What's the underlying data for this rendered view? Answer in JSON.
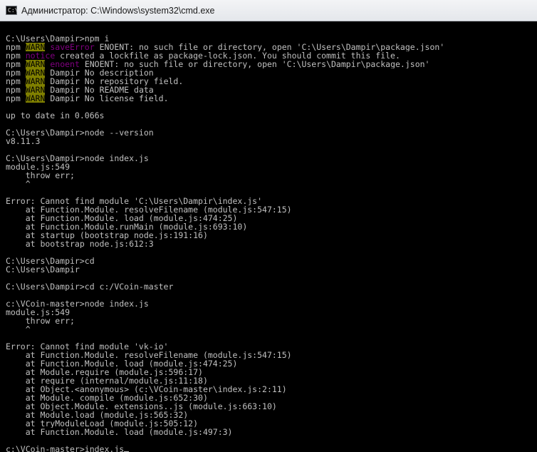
{
  "window": {
    "title": "Администратор: C:\\Windows\\system32\\cmd.exe",
    "icon_text": "C:\\"
  },
  "lines": [
    {
      "segs": [
        {
          "t": ""
        }
      ]
    },
    {
      "segs": [
        {
          "t": "C:\\Users\\Dampir>npm i"
        }
      ]
    },
    {
      "segs": [
        {
          "t": "npm "
        },
        {
          "t": "WARN",
          "c": "warn"
        },
        {
          "t": " "
        },
        {
          "t": "saveError",
          "c": "err"
        },
        {
          "t": " ENOENT: no such file or directory, open 'C:\\Users\\Dampir\\package.json'"
        }
      ]
    },
    {
      "segs": [
        {
          "t": "npm "
        },
        {
          "t": "notice",
          "c": "err"
        },
        {
          "t": " created a lockfile as package-lock.json. You should commit this file."
        }
      ]
    },
    {
      "segs": [
        {
          "t": "npm "
        },
        {
          "t": "WARN",
          "c": "warn"
        },
        {
          "t": " "
        },
        {
          "t": "enoent",
          "c": "err"
        },
        {
          "t": " ENOENT: no such file or directory, open 'C:\\Users\\Dampir\\package.json'"
        }
      ]
    },
    {
      "segs": [
        {
          "t": "npm "
        },
        {
          "t": "WARN",
          "c": "warn"
        },
        {
          "t": " Dampir No description"
        }
      ]
    },
    {
      "segs": [
        {
          "t": "npm "
        },
        {
          "t": "WARN",
          "c": "warn"
        },
        {
          "t": " Dampir No repository field."
        }
      ]
    },
    {
      "segs": [
        {
          "t": "npm "
        },
        {
          "t": "WARN",
          "c": "warn"
        },
        {
          "t": " Dampir No README data"
        }
      ]
    },
    {
      "segs": [
        {
          "t": "npm "
        },
        {
          "t": "WARN",
          "c": "warn"
        },
        {
          "t": " Dampir No license field."
        }
      ]
    },
    {
      "segs": [
        {
          "t": ""
        }
      ]
    },
    {
      "segs": [
        {
          "t": "up to date in 0.066s"
        }
      ]
    },
    {
      "segs": [
        {
          "t": ""
        }
      ]
    },
    {
      "segs": [
        {
          "t": "C:\\Users\\Dampir>node --version"
        }
      ]
    },
    {
      "segs": [
        {
          "t": "v8.11.3"
        }
      ]
    },
    {
      "segs": [
        {
          "t": ""
        }
      ]
    },
    {
      "segs": [
        {
          "t": "C:\\Users\\Dampir>node index.js"
        }
      ]
    },
    {
      "segs": [
        {
          "t": "module.js:549"
        }
      ]
    },
    {
      "segs": [
        {
          "t": "    throw err;"
        }
      ]
    },
    {
      "segs": [
        {
          "t": "    ^"
        }
      ]
    },
    {
      "segs": [
        {
          "t": ""
        }
      ]
    },
    {
      "segs": [
        {
          "t": "Error: Cannot find module 'C:\\Users\\Dampir\\index.js'"
        }
      ]
    },
    {
      "segs": [
        {
          "t": "    at Function.Module._resolveFilename (module.js:547:15)"
        }
      ]
    },
    {
      "segs": [
        {
          "t": "    at Function.Module._load (module.js:474:25)"
        }
      ]
    },
    {
      "segs": [
        {
          "t": "    at Function.Module.runMain (module.js:693:10)"
        }
      ]
    },
    {
      "segs": [
        {
          "t": "    at startup (bootstrap_node.js:191:16)"
        }
      ]
    },
    {
      "segs": [
        {
          "t": "    at bootstrap_node.js:612:3"
        }
      ]
    },
    {
      "segs": [
        {
          "t": ""
        }
      ]
    },
    {
      "segs": [
        {
          "t": "C:\\Users\\Dampir>cd"
        }
      ]
    },
    {
      "segs": [
        {
          "t": "C:\\Users\\Dampir"
        }
      ]
    },
    {
      "segs": [
        {
          "t": ""
        }
      ]
    },
    {
      "segs": [
        {
          "t": "C:\\Users\\Dampir>cd c:/VCoin-master"
        }
      ]
    },
    {
      "segs": [
        {
          "t": ""
        }
      ]
    },
    {
      "segs": [
        {
          "t": "c:\\VCoin-master>node index.js"
        }
      ]
    },
    {
      "segs": [
        {
          "t": "module.js:549"
        }
      ]
    },
    {
      "segs": [
        {
          "t": "    throw err;"
        }
      ]
    },
    {
      "segs": [
        {
          "t": "    ^"
        }
      ]
    },
    {
      "segs": [
        {
          "t": ""
        }
      ]
    },
    {
      "segs": [
        {
          "t": "Error: Cannot find module 'vk-io'"
        }
      ]
    },
    {
      "segs": [
        {
          "t": "    at Function.Module._resolveFilename (module.js:547:15)"
        }
      ]
    },
    {
      "segs": [
        {
          "t": "    at Function.Module._load (module.js:474:25)"
        }
      ]
    },
    {
      "segs": [
        {
          "t": "    at Module.require (module.js:596:17)"
        }
      ]
    },
    {
      "segs": [
        {
          "t": "    at require (internal/module.js:11:18)"
        }
      ]
    },
    {
      "segs": [
        {
          "t": "    at Object.<anonymous> (c:\\VCoin-master\\index.js:2:11)"
        }
      ]
    },
    {
      "segs": [
        {
          "t": "    at Module._compile (module.js:652:30)"
        }
      ]
    },
    {
      "segs": [
        {
          "t": "    at Object.Module._extensions..js (module.js:663:10)"
        }
      ]
    },
    {
      "segs": [
        {
          "t": "    at Module.load (module.js:565:32)"
        }
      ]
    },
    {
      "segs": [
        {
          "t": "    at tryModuleLoad (module.js:505:12)"
        }
      ]
    },
    {
      "segs": [
        {
          "t": "    at Function.Module._load (module.js:497:3)"
        }
      ]
    },
    {
      "segs": [
        {
          "t": ""
        }
      ]
    },
    {
      "segs": [
        {
          "t": "c:\\VCoin-master>index.js"
        }
      ],
      "cursor": true
    }
  ],
  "colors": {
    "background": "#000000",
    "text": "#c0c0c0",
    "warn_bg": "#808000",
    "warn_fg": "#000000",
    "err": "#800080"
  }
}
